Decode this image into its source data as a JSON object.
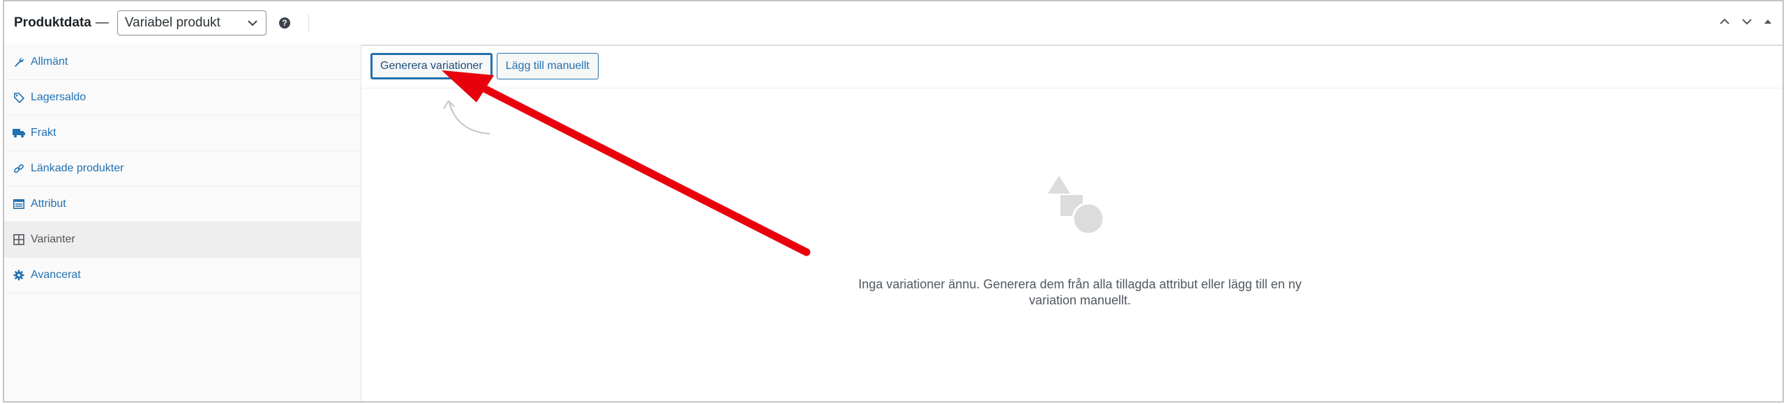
{
  "header": {
    "title": "Produktdata",
    "dash": "—",
    "product_type": "Variabel produkt",
    "help": "?"
  },
  "tabs": [
    {
      "label": "Allmänt",
      "icon": "wrench-icon"
    },
    {
      "label": "Lagersaldo",
      "icon": "tag-icon"
    },
    {
      "label": "Frakt",
      "icon": "truck-icon"
    },
    {
      "label": "Länkade produkter",
      "icon": "link-icon"
    },
    {
      "label": "Attribut",
      "icon": "table-icon"
    },
    {
      "label": "Varianter",
      "icon": "grid-icon",
      "active": true
    },
    {
      "label": "Avancerat",
      "icon": "gear-icon"
    }
  ],
  "toolbar": {
    "generate_label": "Generera variationer",
    "add_manual_label": "Lägg till manuellt"
  },
  "empty_state": {
    "message": "Inga variationer ännu. Generera dem från alla tillagda attribut eller lägg till en ny variation manuellt."
  },
  "colors": {
    "link": "#2271b1",
    "annotation_arrow": "#e8000d"
  }
}
